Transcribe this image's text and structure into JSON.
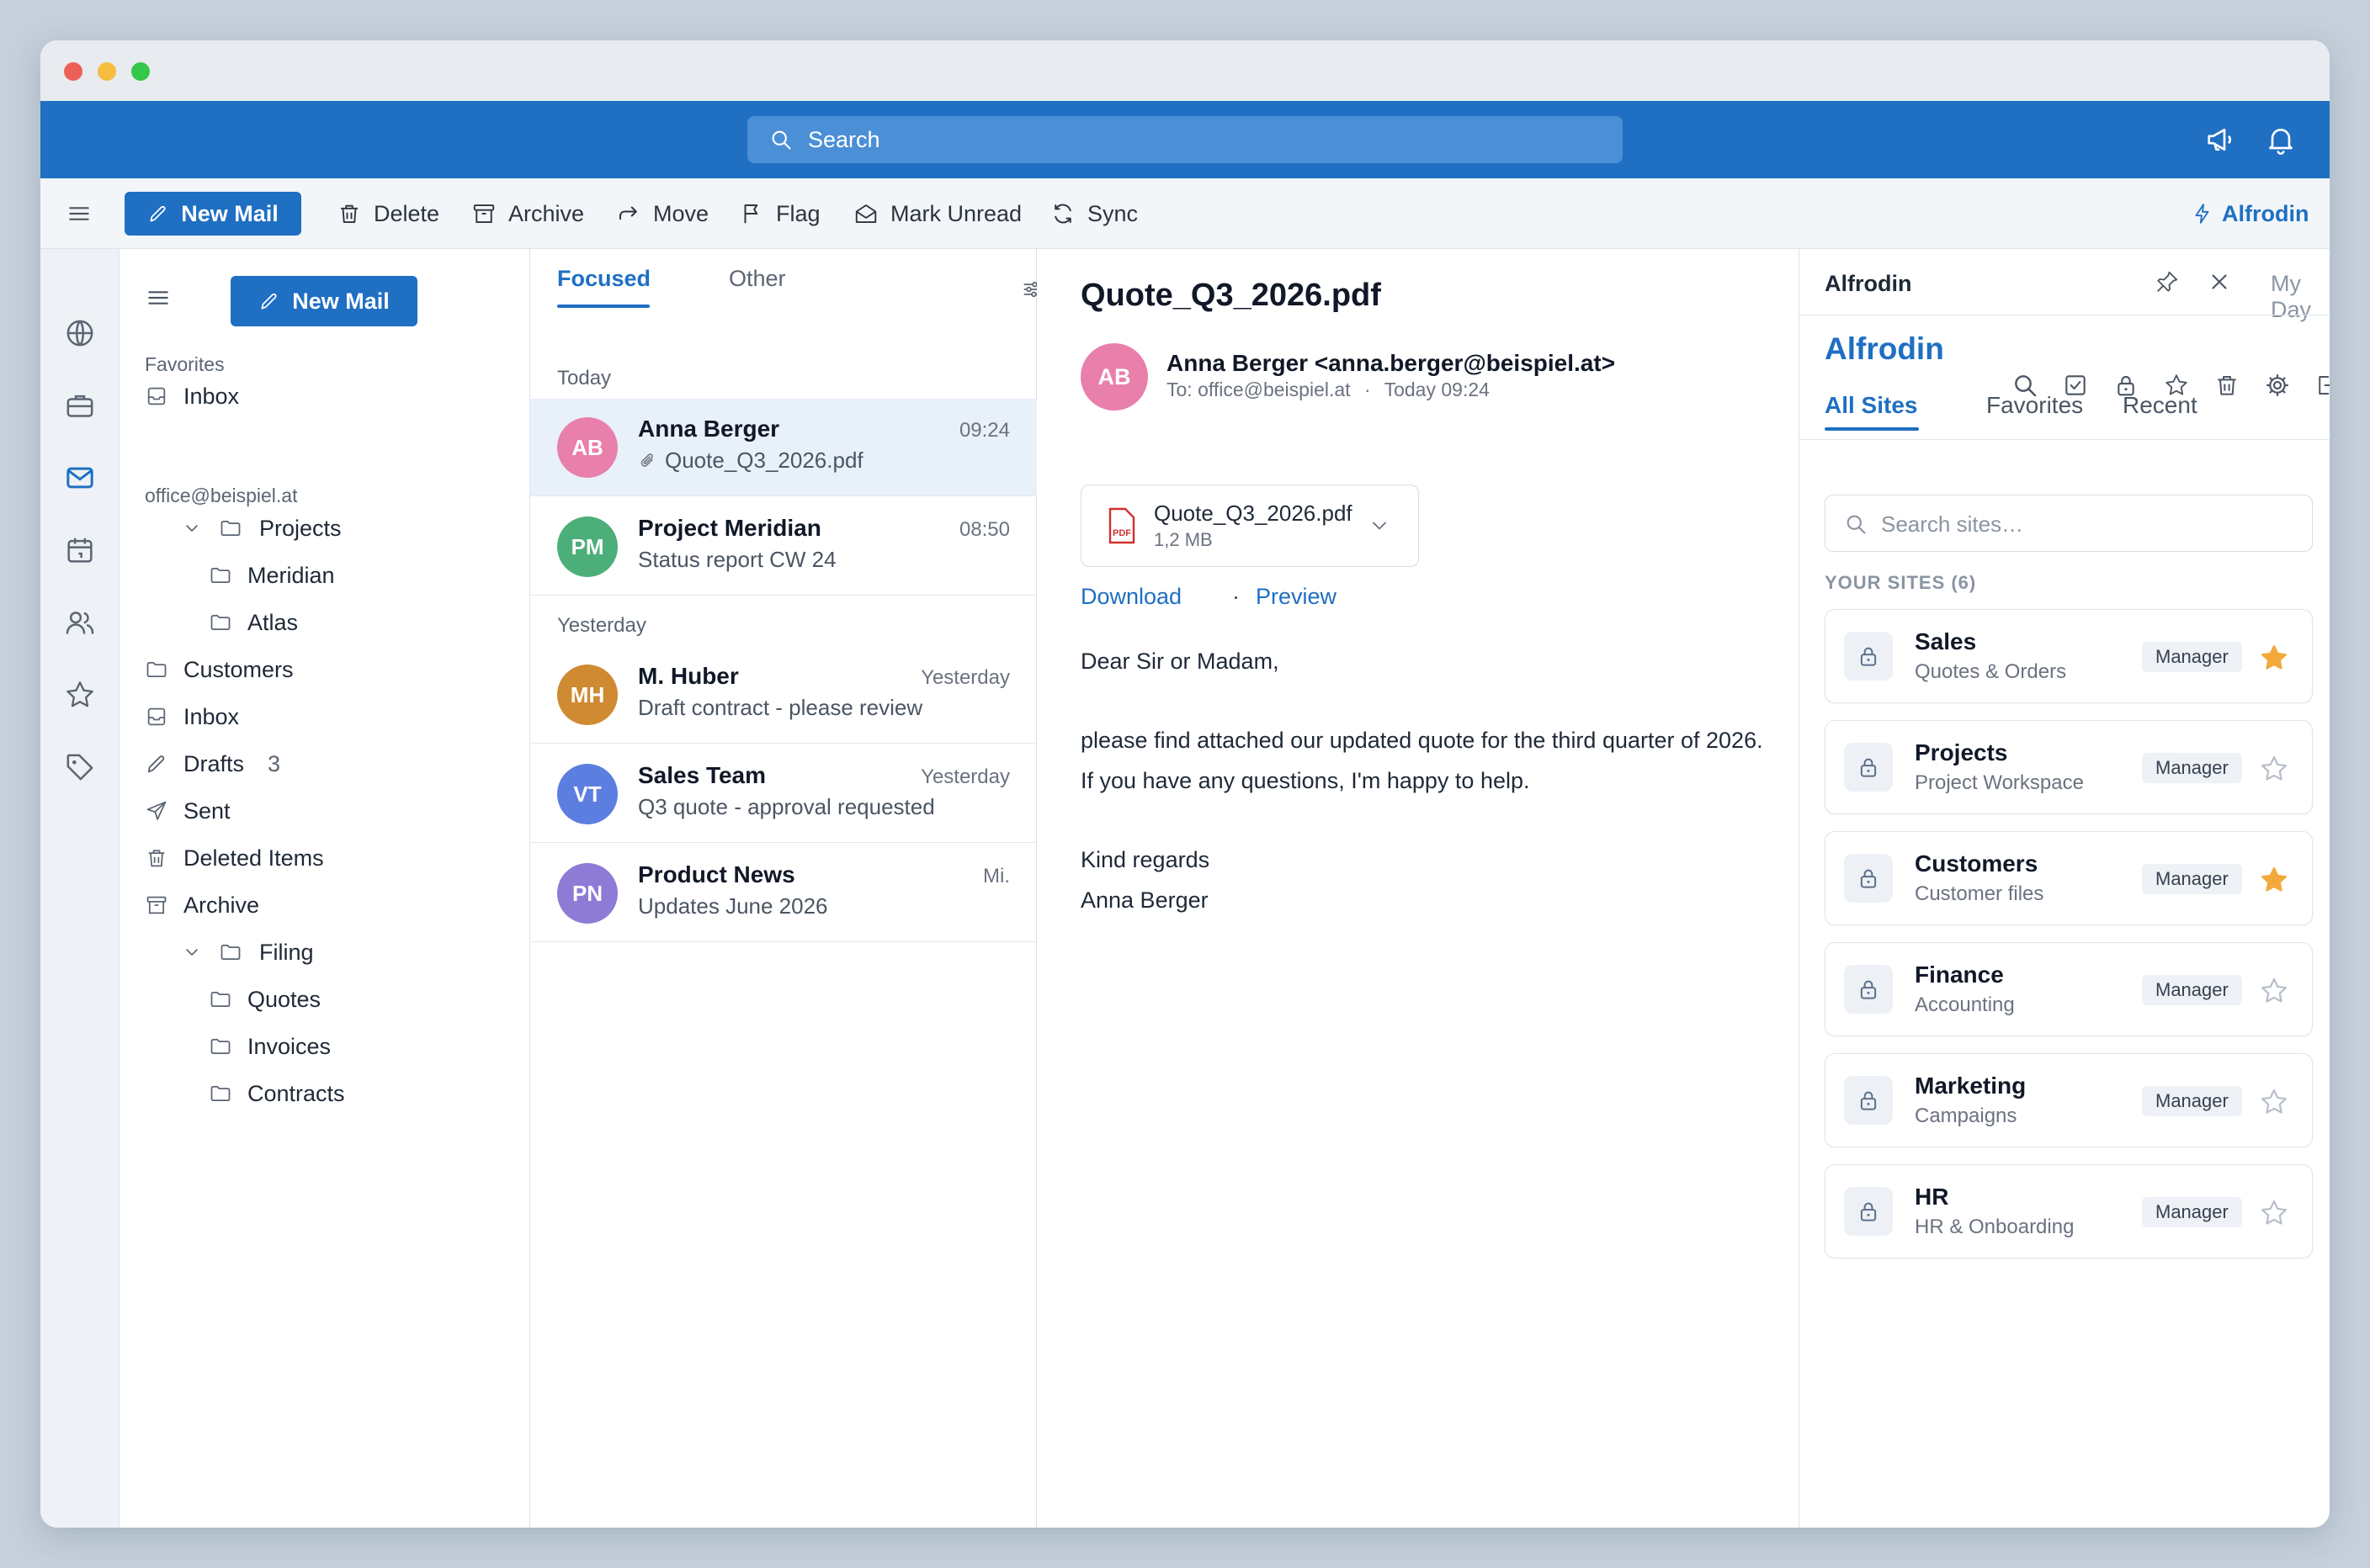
{
  "search": {
    "placeholder": "Search"
  },
  "toolbar": {
    "new_mail": "New Mail",
    "delete": "Delete",
    "archive": "Archive",
    "move": "Move",
    "flag": "Flag",
    "mark_unread": "Mark Unread",
    "sync": "Sync",
    "addin": "Alfrodin"
  },
  "folders": {
    "new_mail": "New Mail",
    "favorites_label": "Favorites",
    "favorites_inbox": "Inbox",
    "account": "office@beispiel.at",
    "projects": "Projects",
    "meridian": "Meridian",
    "atlas": "Atlas",
    "customers": "Customers",
    "inbox": "Inbox",
    "drafts": "Drafts",
    "drafts_count": "3",
    "sent": "Sent",
    "deleted": "Deleted Items",
    "archive": "Archive",
    "filing": "Filing",
    "quotes": "Quotes",
    "invoices": "Invoices",
    "contracts": "Contracts"
  },
  "list": {
    "tab_focused": "Focused",
    "tab_other": "Other",
    "group_today": "Today",
    "group_yesterday": "Yesterday",
    "messages": [
      {
        "initials": "AB",
        "from": "Anna Berger",
        "subject": "Quote_Q3_2026.pdf",
        "time": "09:24",
        "color": "#e97fab"
      },
      {
        "initials": "PM",
        "from": "Project Meridian",
        "subject": "Status report CW 24",
        "time": "08:50",
        "color": "#4caf7a"
      },
      {
        "initials": "MH",
        "from": "M. Huber",
        "subject": "Draft contract - please review",
        "time": "Yesterday",
        "color": "#cf8a32"
      },
      {
        "initials": "VT",
        "from": "Sales Team",
        "subject": "Q3 quote - approval requested",
        "time": "Yesterday",
        "color": "#5b7ee0"
      },
      {
        "initials": "PN",
        "from": "Product News",
        "subject": "Updates June 2026",
        "time": "Mi.",
        "color": "#8e7bd6"
      }
    ]
  },
  "reading": {
    "title": "Quote_Q3_2026.pdf",
    "initials": "AB",
    "from": "Anna Berger <anna.berger@beispiel.at>",
    "to": "To: office@beispiel.at",
    "sep": "·",
    "date": "Today 09:24",
    "attachment_name": "Quote_Q3_2026.pdf",
    "attachment_size": "1,2 MB",
    "pdf_badge": "PDF",
    "download": "Download",
    "link_sep": "·",
    "preview": "Preview",
    "greeting": "Dear Sir or Madam,",
    "body": "please find attached our updated quote for the third quarter of 2026. If you have any questions, I'm happy to help.",
    "closing": "Kind regards",
    "signature": "Anna Berger"
  },
  "side": {
    "header": "Alfrodin",
    "my_day": "My Day",
    "brand": "Alfrodin",
    "tab_all": "All Sites",
    "tab_favorites": "Favorites",
    "tab_recent": "Recent",
    "search_placeholder": "Search sites…",
    "your_sites": "YOUR SITES (6)",
    "sites": [
      {
        "name": "Sales",
        "sub": "Quotes & Orders",
        "role": "Manager",
        "starred": true
      },
      {
        "name": "Projects",
        "sub": "Project Workspace",
        "role": "Manager",
        "starred": false
      },
      {
        "name": "Customers",
        "sub": "Customer files",
        "role": "Manager",
        "starred": true
      },
      {
        "name": "Finance",
        "sub": "Accounting",
        "role": "Manager",
        "starred": false
      },
      {
        "name": "Marketing",
        "sub": "Campaigns",
        "role": "Manager",
        "starred": false
      },
      {
        "name": "HR",
        "sub": "HR & Onboarding",
        "role": "Manager",
        "starred": false
      }
    ]
  },
  "colors": {
    "accent": "#1f6fc3",
    "star": "#f2a93b"
  }
}
